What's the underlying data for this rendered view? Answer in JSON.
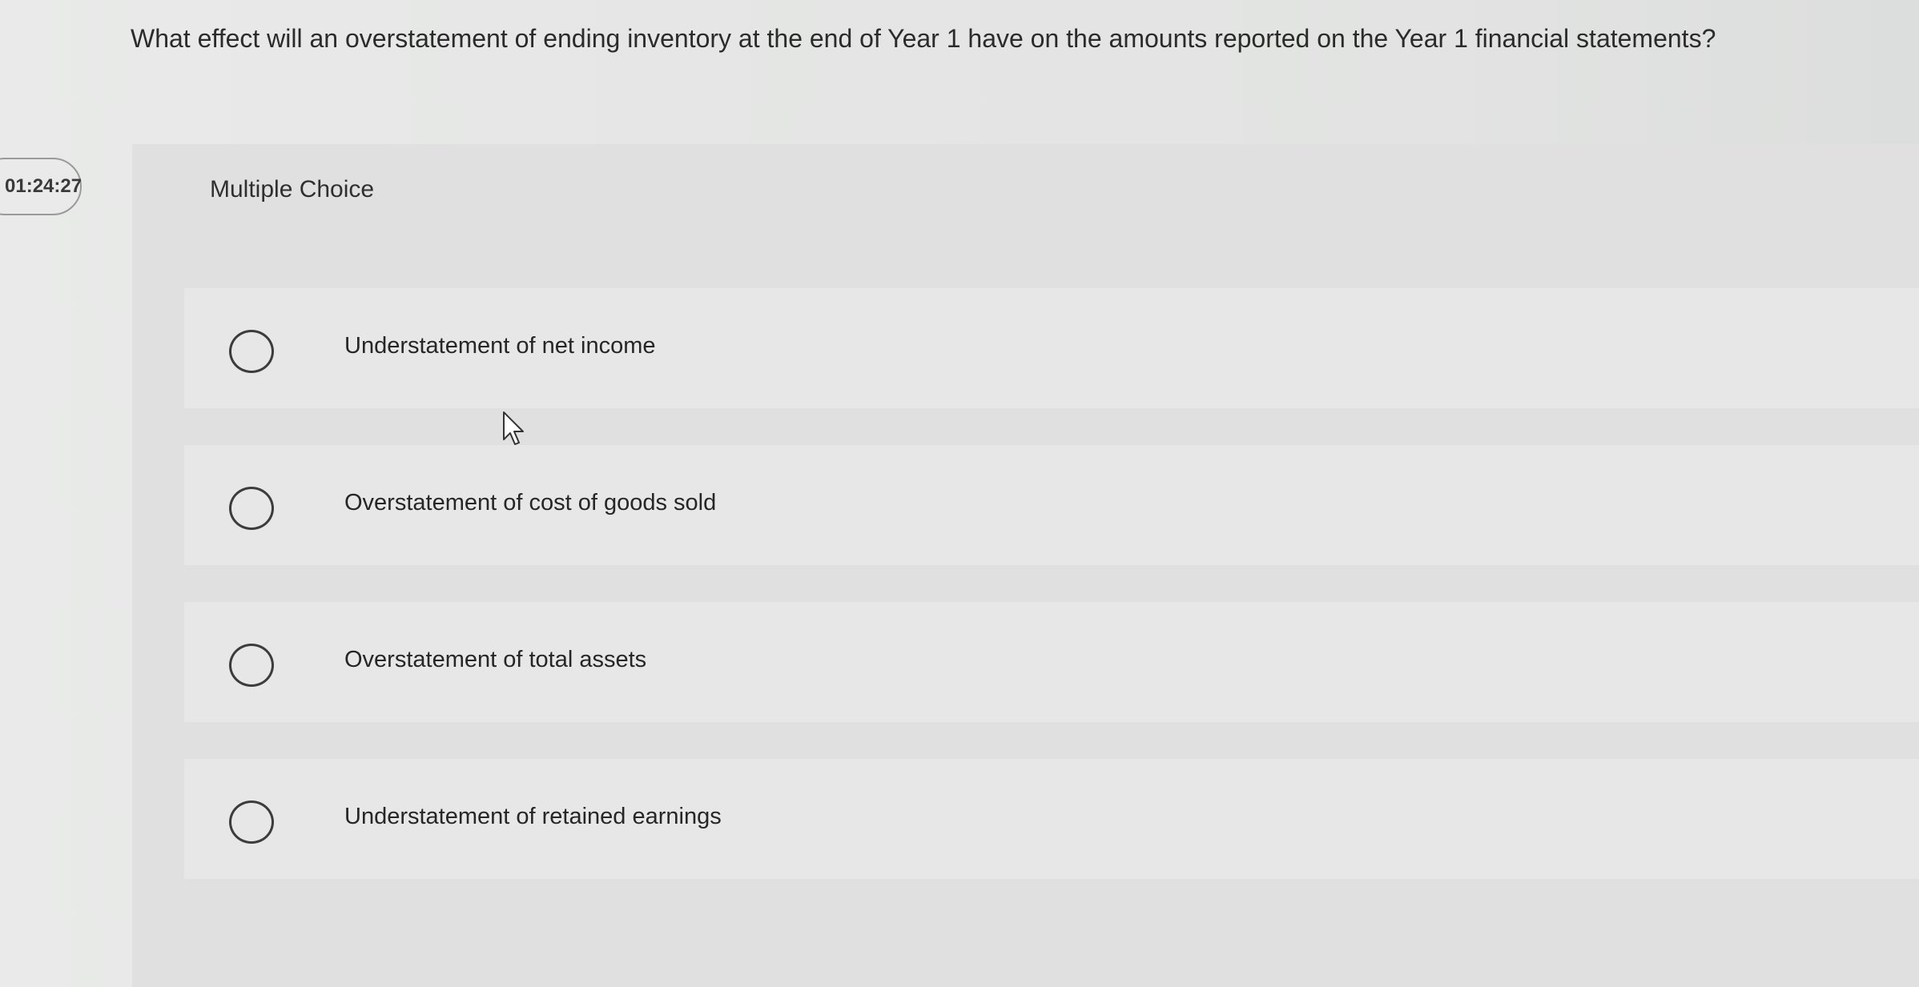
{
  "question": {
    "text": "What effect will an overstatement of ending inventory at the end of Year 1 have on the amounts reported on the Year 1 financial statements?"
  },
  "timer": {
    "value": "01:24:27"
  },
  "panel": {
    "heading": "Multiple Choice"
  },
  "options": [
    {
      "label": "Understatement of net income"
    },
    {
      "label": "Overstatement of cost of goods sold"
    },
    {
      "label": "Overstatement of total assets"
    },
    {
      "label": "Understatement of retained earnings"
    }
  ],
  "icons": {
    "radio": "radio-unselected-icon",
    "cursor": "mouse-pointer-icon"
  }
}
